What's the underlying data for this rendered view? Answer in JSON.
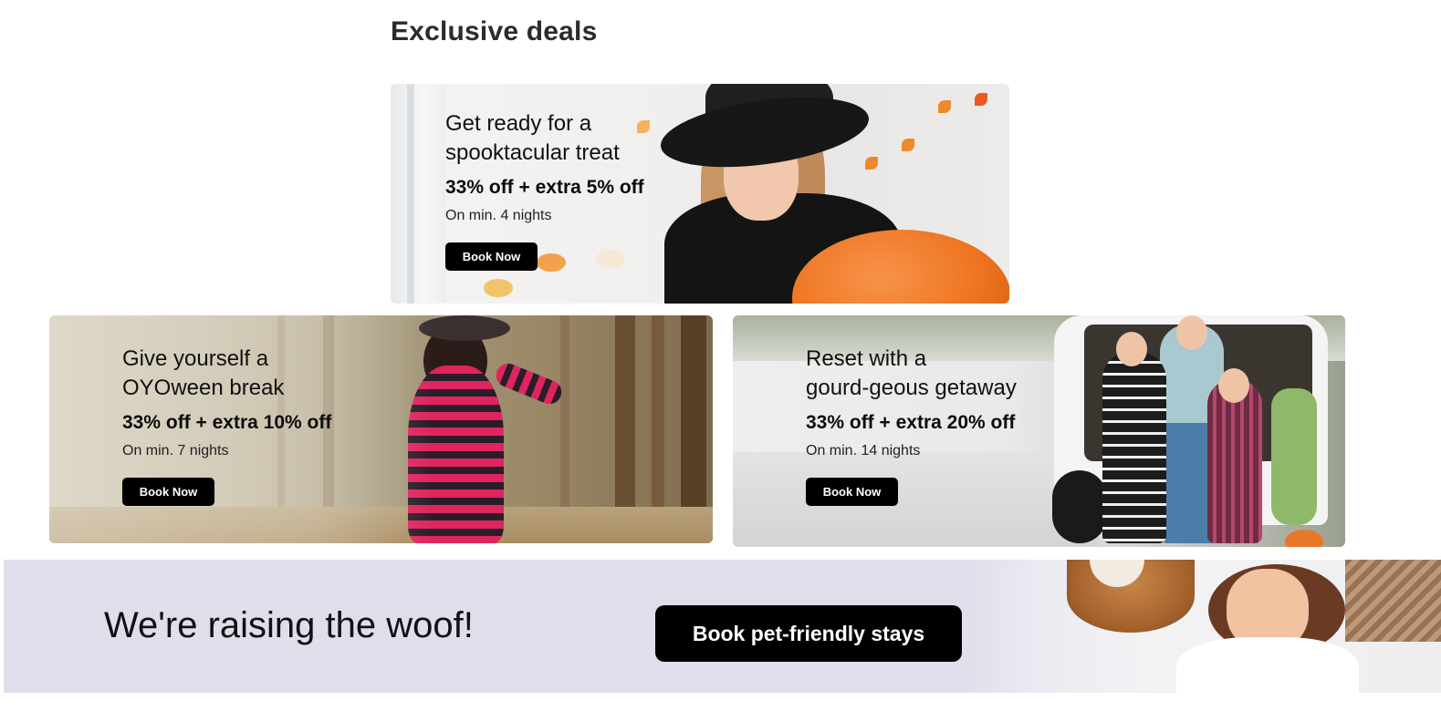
{
  "section": {
    "title": "Exclusive deals"
  },
  "deals": [
    {
      "headline_line1": "Get ready for a",
      "headline_line2": "spooktacular treat",
      "offer": "33% off + extra 5% off",
      "note": "On min. 4 nights",
      "button": "Book Now"
    },
    {
      "headline_line1": "Give yourself a",
      "headline_line2": "OYOween break",
      "offer": "33% off + extra 10% off",
      "note": "On min. 7 nights",
      "button": "Book Now"
    },
    {
      "headline_line1": "Reset with a",
      "headline_line2": "gourd-geous getaway",
      "offer": "33% off + extra 20% off",
      "note": "On min. 14 nights",
      "button": "Book Now"
    }
  ],
  "pet_banner": {
    "title": "We're raising the woof!",
    "button": "Book pet-friendly stays"
  },
  "colors": {
    "button_bg": "#000000",
    "pet_banner_bg": "#dfdfec",
    "title_text": "#2b2b2b"
  }
}
